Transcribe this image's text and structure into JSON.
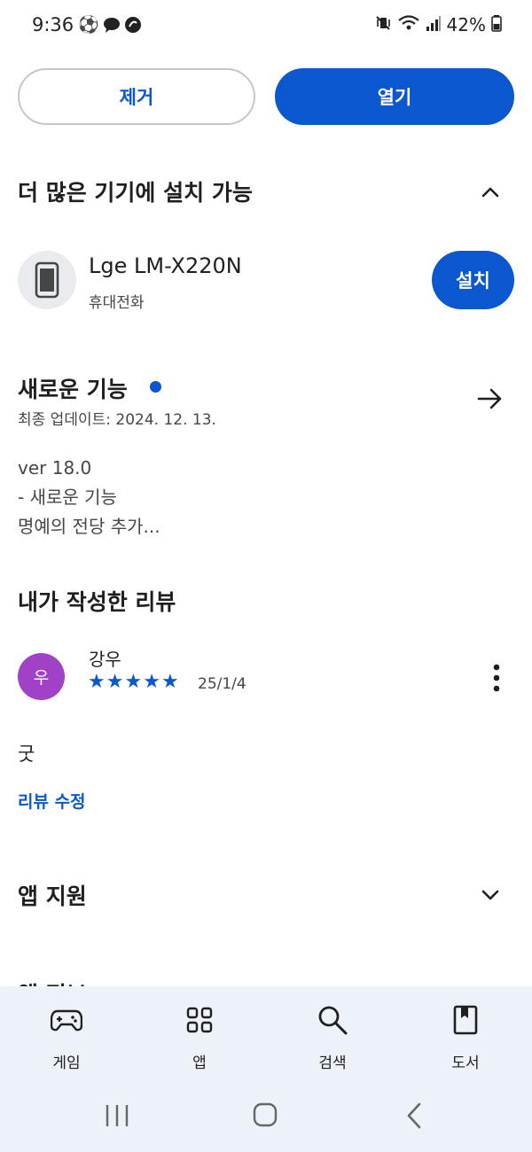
{
  "status_bar": {
    "time": "9:36",
    "battery": "42%",
    "left_icons": [
      "soccer-ball-icon",
      "chat-bubble-icon",
      "app-icon"
    ],
    "right_icons": [
      "vibrate-off-icon",
      "wifi-icon",
      "signal-icon",
      "battery-icon"
    ]
  },
  "actions": {
    "remove_label": "제거",
    "open_label": "열기"
  },
  "more_devices": {
    "title": "더 많은 기기에 설치 가능",
    "device": {
      "name": "Lge LM-X220N",
      "type": "휴대전화",
      "install_label": "설치"
    }
  },
  "whats_new": {
    "title": "새로운 기능",
    "updated": "최종 업데이트: 2024. 12. 13.",
    "notes": [
      "ver 18.0",
      "- 새로운 기능",
      "명예의 전당 추가..."
    ]
  },
  "my_review": {
    "title": "내가 작성한 리뷰",
    "reviewer": "강우",
    "avatar_letter": "우",
    "rating": 5,
    "date": "25/1/4",
    "text": "굿",
    "edit_label": "리뷰 수정"
  },
  "app_support": {
    "title": "앱 지원"
  },
  "cut_section": {
    "title": "앱 정보"
  },
  "bottom_nav": {
    "items": [
      {
        "label": "게임",
        "icon": "gamepad-icon"
      },
      {
        "label": "앱",
        "icon": "apps-grid-icon"
      },
      {
        "label": "검색",
        "icon": "search-icon"
      },
      {
        "label": "도서",
        "icon": "book-icon"
      }
    ]
  },
  "colors": {
    "accent": "#0b57d0",
    "avatar": "#a142c6",
    "nav_bg": "#edf1f8"
  }
}
